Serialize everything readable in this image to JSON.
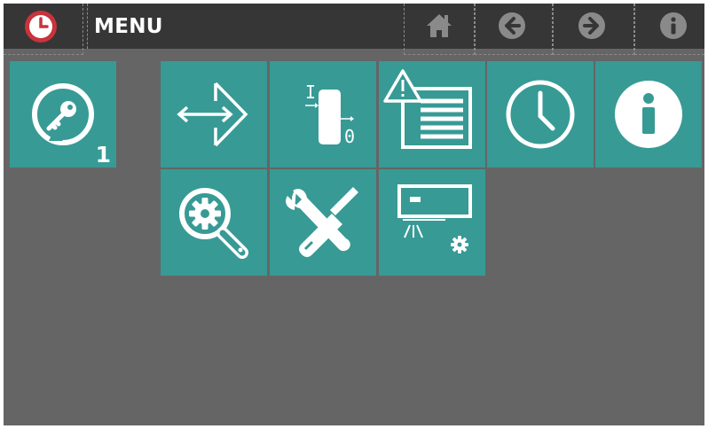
{
  "header": {
    "title": "MENU",
    "clock_icon": "clock-icon",
    "home_icon": "home-icon",
    "back_icon": "arrow-left-circle-icon",
    "forward_icon": "arrow-right-circle-icon",
    "info_icon": "info-circle-icon"
  },
  "login": {
    "icon": "key-icon",
    "access_level": "1"
  },
  "menu_tiles": [
    {
      "icon": "io-arrows-icon",
      "name": "io"
    },
    {
      "icon": "digital-io-icon",
      "name": "digital-io"
    },
    {
      "icon": "alarm-list-icon",
      "name": "alarms"
    },
    {
      "icon": "clock-icon",
      "name": "clock"
    },
    {
      "icon": "info-icon",
      "name": "info"
    },
    {
      "icon": "settings-search-icon",
      "name": "settings-search"
    },
    {
      "icon": "tools-icon",
      "name": "service-tools"
    },
    {
      "icon": "unit-settings-icon",
      "name": "unit-settings"
    }
  ],
  "colors": {
    "background": "#656565",
    "topbar": "#363636",
    "tile": "#379a95",
    "clock_accent": "#c8333c",
    "icon_light": "#ffffff",
    "toolbar_icon": "#8a8a8a"
  }
}
